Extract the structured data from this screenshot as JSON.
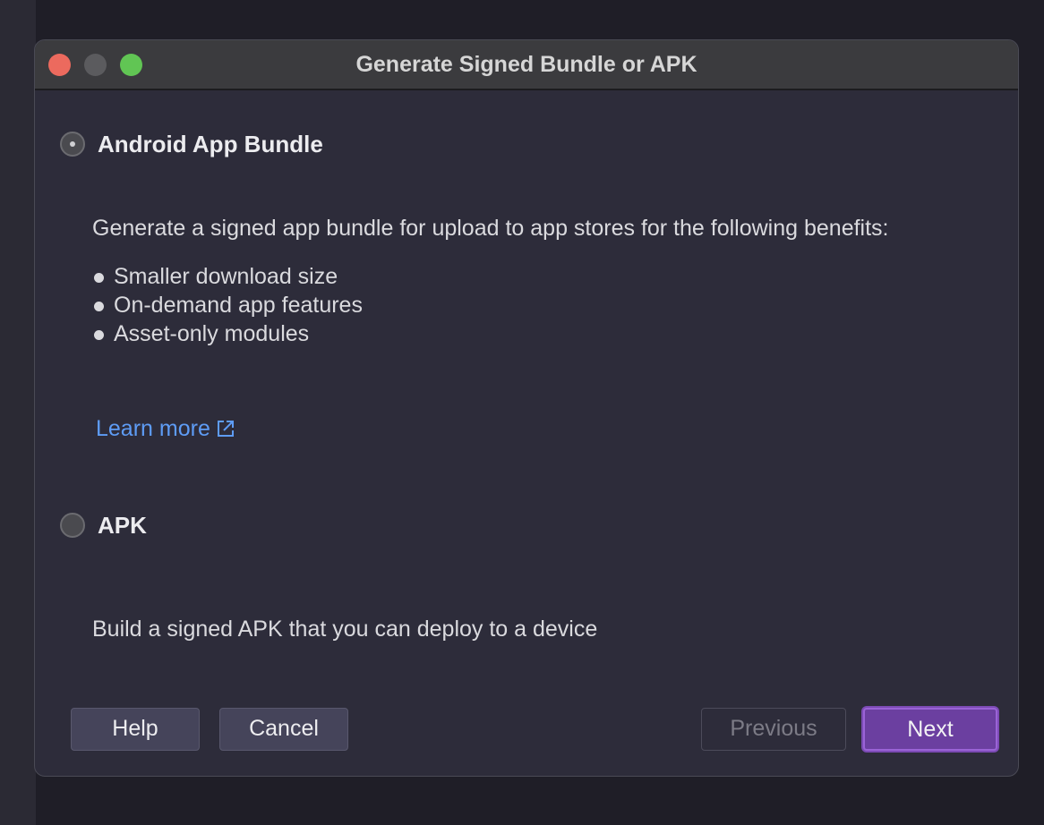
{
  "window": {
    "title": "Generate Signed Bundle or APK"
  },
  "options": {
    "bundle": {
      "label": "Android App Bundle",
      "selected": true,
      "description": "Generate a signed app bundle for upload to app stores for the following benefits:",
      "benefits": [
        "Smaller download size",
        "On-demand app features",
        "Asset-only modules"
      ],
      "learn_more": "Learn more"
    },
    "apk": {
      "label": "APK",
      "selected": false,
      "description": "Build a signed APK that you can deploy to a device"
    }
  },
  "buttons": {
    "help": "Help",
    "cancel": "Cancel",
    "previous": "Previous",
    "next": "Next"
  },
  "colors": {
    "accent": "#6b3fa0",
    "link": "#5e9cf5",
    "close": "#ec6a5e",
    "zoom": "#61c554"
  },
  "icons": {
    "learn_more": "external-link-icon"
  }
}
